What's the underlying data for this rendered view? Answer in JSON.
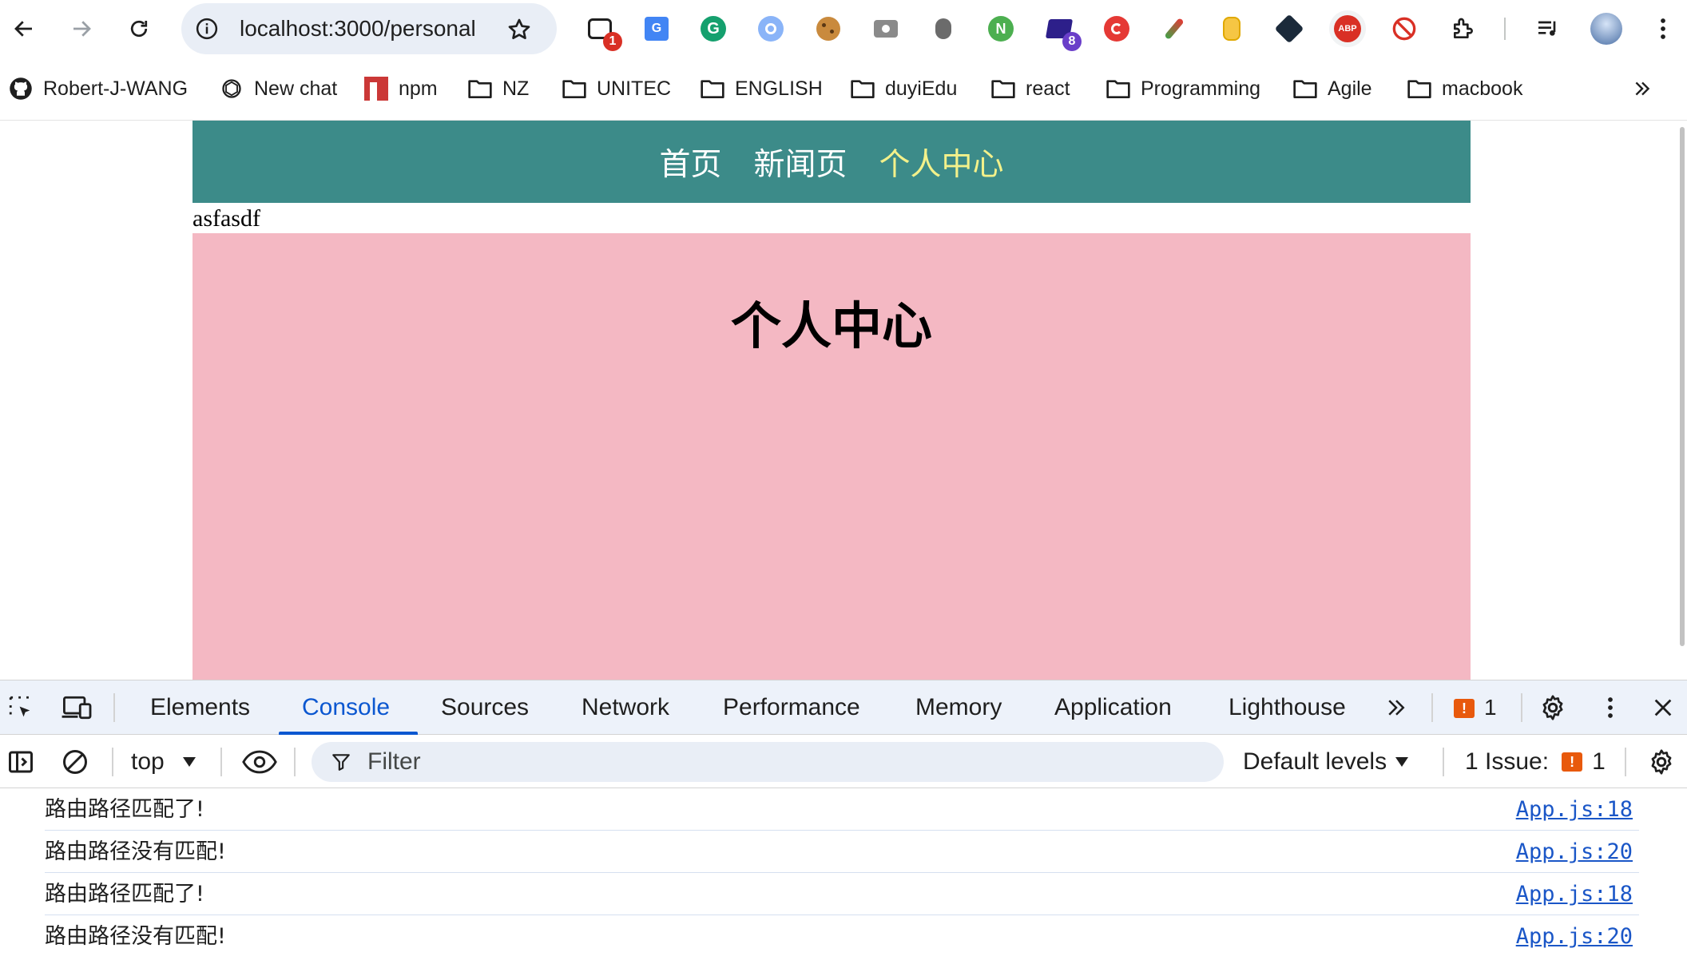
{
  "browser": {
    "url": "localhost:3000/personal",
    "extensions": [
      {
        "name": "chatgpt-extension",
        "badge": "1",
        "badge_color": "#d93025"
      },
      {
        "name": "google-translate-icon",
        "badge": ""
      },
      {
        "name": "grammarly-icon",
        "badge": ""
      },
      {
        "name": "search-extension-icon",
        "badge": ""
      },
      {
        "name": "cookie-icon",
        "badge": ""
      },
      {
        "name": "camera-icon",
        "badge": ""
      },
      {
        "name": "bug-icon",
        "badge": ""
      },
      {
        "name": "node-icon",
        "badge": ""
      },
      {
        "name": "extension-8-icon",
        "badge": "8",
        "badge_color": "#6a3ec9"
      },
      {
        "name": "sync-icon",
        "badge": ""
      },
      {
        "name": "feather-icon",
        "badge": ""
      },
      {
        "name": "mouse-icon",
        "badge": ""
      },
      {
        "name": "devtool-icon",
        "badge": ""
      },
      {
        "name": "adblock-icon",
        "label": "ABP"
      },
      {
        "name": "block-icon",
        "badge": ""
      }
    ]
  },
  "bookmarks": [
    {
      "label": "Robert-J-WANG",
      "icon": "github-icon"
    },
    {
      "label": "New chat",
      "icon": "openai-icon"
    },
    {
      "label": "npm",
      "icon": "npm-icon"
    },
    {
      "label": "NZ",
      "icon": "folder-icon"
    },
    {
      "label": "UNITEC",
      "icon": "folder-icon"
    },
    {
      "label": "ENGLISH",
      "icon": "folder-icon"
    },
    {
      "label": "duyiEdu",
      "icon": "folder-icon"
    },
    {
      "label": "react",
      "icon": "folder-icon"
    },
    {
      "label": "Programming",
      "icon": "folder-icon"
    },
    {
      "label": "Agile",
      "icon": "folder-icon"
    },
    {
      "label": "macbook",
      "icon": "folder-icon"
    }
  ],
  "page": {
    "nav": [
      {
        "label": "首页",
        "active": false
      },
      {
        "label": "新闻页",
        "active": false
      },
      {
        "label": "个人中心",
        "active": true
      }
    ],
    "stray_text": "asfasdf",
    "panel_title": "个人中心",
    "colors": {
      "nav_bg": "#3c8b89",
      "nav_active": "#f3f18a",
      "panel_bg": "#f4b8c3"
    }
  },
  "devtools": {
    "tabs": [
      "Elements",
      "Console",
      "Sources",
      "Network",
      "Performance",
      "Memory",
      "Application",
      "Lighthouse"
    ],
    "active_tab": "Console",
    "issues_badge": "1",
    "context": "top",
    "filter_placeholder": "Filter",
    "levels": "Default levels",
    "issues_label": "1 Issue:",
    "issues_count": "1",
    "logs": [
      {
        "message": "路由路径匹配了!",
        "source": "App.js:18"
      },
      {
        "message": "路由路径没有匹配!",
        "source": "App.js:20"
      },
      {
        "message": "路由路径匹配了!",
        "source": "App.js:18"
      },
      {
        "message": "路由路径没有匹配!",
        "source": "App.js:20"
      }
    ]
  }
}
